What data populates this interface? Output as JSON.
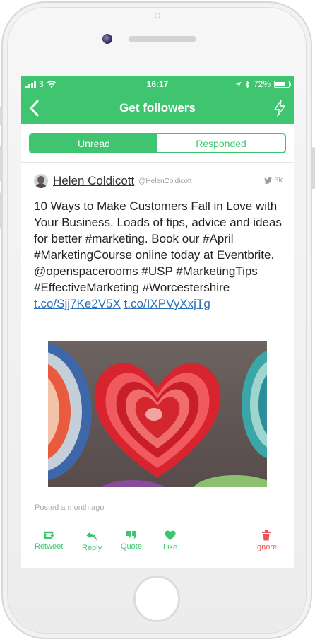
{
  "status_bar": {
    "carrier": "3",
    "time": "16:17",
    "battery": "72%",
    "battery_level": 0.72
  },
  "nav": {
    "title": "Get followers",
    "back_icon": "chevron-left-icon",
    "action_icon": "lightning-icon"
  },
  "tabs": [
    {
      "label": "Unread",
      "active": true
    },
    {
      "label": "Responded",
      "active": false
    }
  ],
  "tweet": {
    "author": "Helen Coldicott",
    "handle": "@HelenColdicott",
    "followers": "3k",
    "text": "10 Ways to Make Customers Fall in Love with Your Business. Loads of tips, advice and ideas for better #marketing. Book our #April #MarketingCourse online today at Eventbrite.  @openspacerooms #USP #MarketingTips #EffectiveMarketing #Worcestershire ",
    "link1": "t.co/Sjj7Ke2V5X",
    "link2": "t.co/IXPVyXxjTg",
    "image_icon": "heart-bowls-photo",
    "posted": "Posted a month ago"
  },
  "actions": {
    "retweet": "Retweet",
    "reply": "Reply",
    "quote": "Quote",
    "like": "Like",
    "ignore": "Ignore"
  },
  "colors": {
    "brand": "#3fc56f",
    "ignore": "#e8545a",
    "link": "#2a6fb8"
  }
}
